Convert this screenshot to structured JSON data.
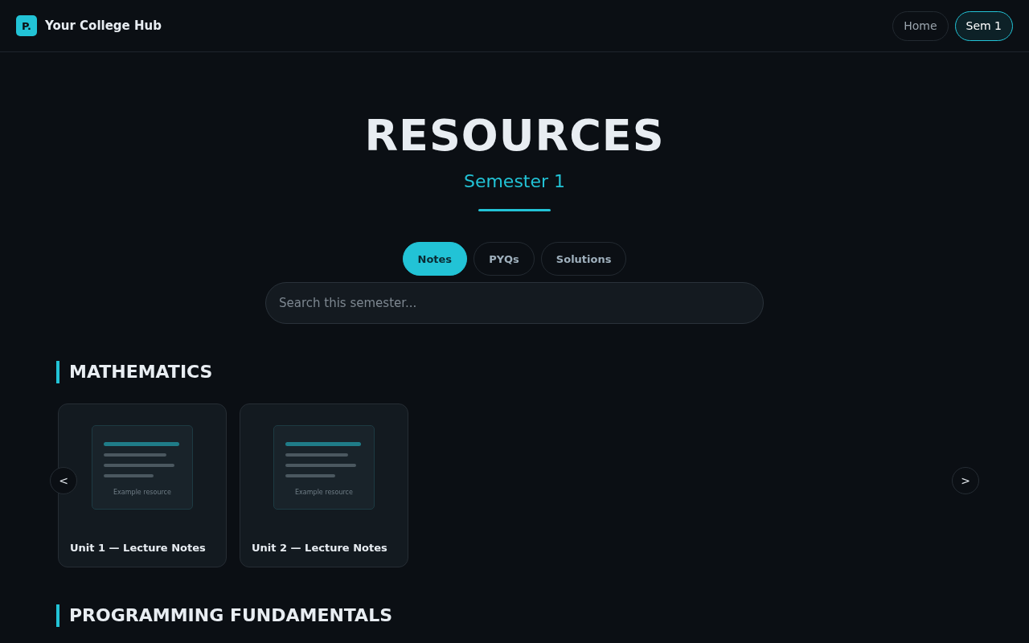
{
  "header": {
    "logo": "P.",
    "title": "Your College Hub",
    "nav": [
      {
        "label": "Home",
        "selected": false
      },
      {
        "label": "Sem 1",
        "selected": true
      }
    ]
  },
  "hero": {
    "title": "RESOURCES",
    "subtitle": "Semester 1"
  },
  "tabs": [
    {
      "label": "Notes",
      "selected": true
    },
    {
      "label": "PYQs",
      "selected": false
    },
    {
      "label": "Solutions",
      "selected": false
    }
  ],
  "search": {
    "placeholder": "Search this semester..."
  },
  "sections": [
    {
      "title": "MATHEMATICS",
      "prev": "<",
      "next": ">",
      "cards": [
        {
          "preview_caption": "Example resource",
          "title": "Unit 1 — Lecture Notes"
        },
        {
          "preview_caption": "Example resource",
          "title": "Unit 2 — Lecture Notes"
        }
      ]
    },
    {
      "title": "PROGRAMMING FUNDAMENTALS"
    }
  ]
}
